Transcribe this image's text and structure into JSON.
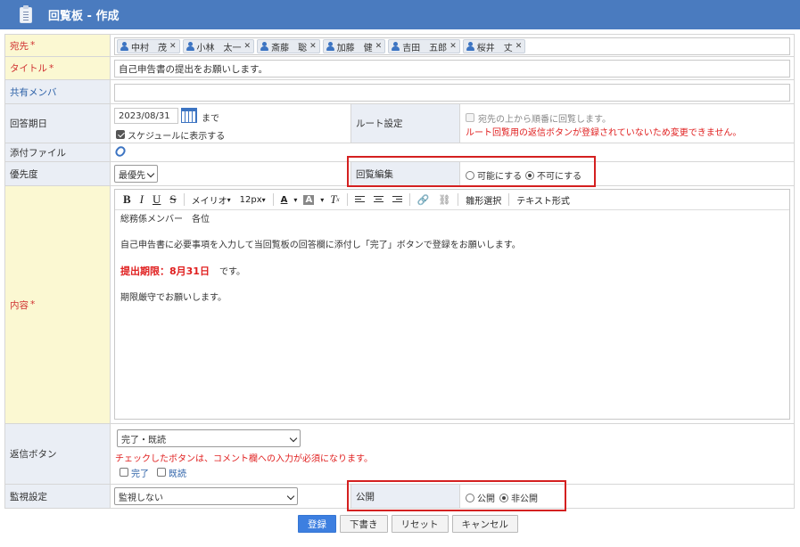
{
  "header": {
    "title": "回覧板 - 作成",
    "icon": "clipboard-icon"
  },
  "labels": {
    "recipients": "宛先",
    "title": "タイトル",
    "shared_members": "共有メンバ",
    "due_date": "回答期日",
    "route": "ルート設定",
    "attachment": "添付ファイル",
    "priority": "優先度",
    "reply_edit": "回覧編集",
    "content": "内容",
    "reply_buttons": "返信ボタン",
    "monitor": "監視設定",
    "publish": "公開",
    "required_mark": "*"
  },
  "recipients": [
    {
      "name": "中村　茂"
    },
    {
      "name": "小林　太一"
    },
    {
      "name": "斎藤　聡"
    },
    {
      "name": "加藤　健"
    },
    {
      "name": "吉田　五郎"
    },
    {
      "name": "桜井　丈"
    }
  ],
  "title_value": "自己申告書の提出をお願いします。",
  "shared_members_value": "",
  "due_date": {
    "value": "2023/08/31",
    "suffix": "まで",
    "show_schedule_label": "スケジュールに表示する",
    "show_schedule_checked": true
  },
  "route": {
    "sequential_label": "宛先の上から順番に回覧します。",
    "warning": "ルート回覧用の返信ボタンが登録されていないため変更できません。"
  },
  "priority": {
    "selected": "最優先"
  },
  "reply_edit": {
    "option_allow": "可能にする",
    "option_deny": "不可にする",
    "selected": "deny"
  },
  "toolbar": {
    "font": "メイリオ",
    "size": "12px",
    "template_select": "雛形選択",
    "text_format": "テキスト形式"
  },
  "content": {
    "line1": "総務係メンバー　各位",
    "line2": "自己申告書に必要事項を入力して当回覧板の回答欄に添付し「完了」ボタンで登録をお願いします。",
    "deadline_label": "提出期限：8月31日",
    "deadline_suffix": "です。",
    "line4": "期限厳守でお願いします。"
  },
  "reply_buttons": {
    "selected": "完了・既読",
    "note": "チェックしたボタンは、コメント欄への入力が必須になります。",
    "opt_done": "完了",
    "opt_read": "既読"
  },
  "monitor": {
    "selected": "監視しない"
  },
  "publish": {
    "option_public": "公開",
    "option_private": "非公開",
    "selected": "private"
  },
  "actions": {
    "register": "登録",
    "draft": "下書き",
    "reset": "リセット",
    "cancel": "キャンセル"
  },
  "colors": {
    "header_bg": "#4a7bbf",
    "required_label_bg": "#fbf8d2",
    "label_bg": "#eaeef5",
    "warning_red": "#e02020",
    "primary_button": "#3d7fe0",
    "highlight_box": "#d42020"
  }
}
